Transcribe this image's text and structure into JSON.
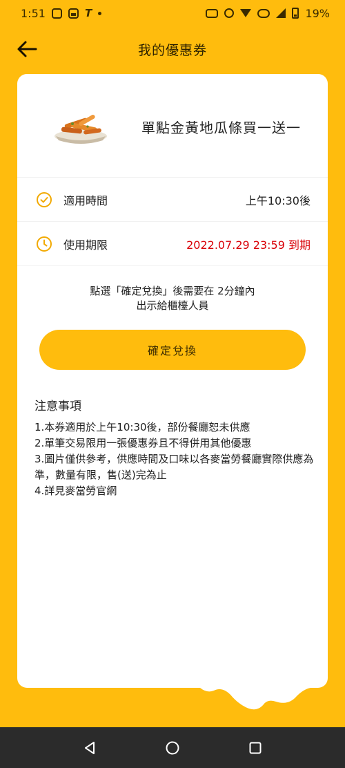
{
  "status_bar": {
    "time": "1:51",
    "battery": "19%"
  },
  "header": {
    "title": "我的優惠券"
  },
  "coupon": {
    "product_name": "單點金黃地瓜條買一送一",
    "applicable_time_label": "適用時間",
    "applicable_time_value": "上午10:30後",
    "expiry_label": "使用期限",
    "expiry_value": "2022.07.29 23:59 到期"
  },
  "hint": {
    "line1": "點選「確定兌換」後需要在 2分鐘內",
    "line2": "出示給櫃檯人員"
  },
  "confirm_button": "確定兌換",
  "notes": {
    "title": "注意事項",
    "items": [
      "1.本券適用於上午10:30後，部份餐廳恕未供應",
      "2.單筆交易限用一張優惠券且不得併用其他優惠",
      "3.圖片僅供參考，供應時間及口味以各麥當勞餐廳實際供應為準，數量有限，售(送)完為止",
      "4.詳見麥當勞官網"
    ]
  },
  "colors": {
    "brand_yellow": "#FFBC0D",
    "expiry_red": "#D90007",
    "nav_bar": "#2b2b2b"
  },
  "icons": [
    "back-arrow-icon",
    "check-circle-icon",
    "clock-icon",
    "nav-back-icon",
    "nav-home-icon",
    "nav-recents-icon"
  ]
}
